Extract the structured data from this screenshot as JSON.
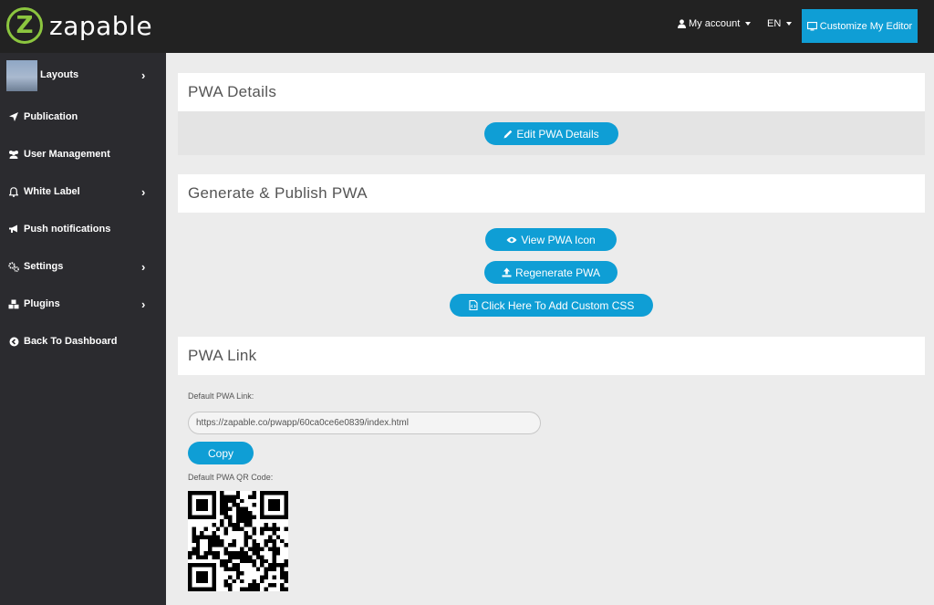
{
  "brand": {
    "logo_letter": "Z",
    "name": "zapable",
    "accent": "#8cc63f"
  },
  "topbar": {
    "account_label": "My account",
    "lang_label": "EN",
    "customize_label": "Customize My Editor",
    "account_icon": "user-icon",
    "customize_icon": "monitor-icon"
  },
  "sidebar": {
    "items": [
      {
        "label": "Layouts",
        "icon": "layouts-thumbnail",
        "has_chevron": true
      },
      {
        "label": "Publication",
        "icon": "paper-plane-icon",
        "has_chevron": false
      },
      {
        "label": "User Management",
        "icon": "users-icon",
        "has_chevron": false
      },
      {
        "label": "White Label",
        "icon": "bell-icon",
        "has_chevron": true
      },
      {
        "label": "Push notifications",
        "icon": "bullhorn-icon",
        "has_chevron": false
      },
      {
        "label": "Settings",
        "icon": "cogs-icon",
        "has_chevron": true
      },
      {
        "label": "Plugins",
        "icon": "cubes-icon",
        "has_chevron": true
      },
      {
        "label": "Back To Dashboard",
        "icon": "arrow-circle-left-icon",
        "has_chevron": false
      }
    ]
  },
  "pwa_details": {
    "title": "PWA Details",
    "edit_label": "Edit PWA Details"
  },
  "generate": {
    "title": "Generate & Publish PWA",
    "view_icon_label": "View PWA Icon",
    "regenerate_label": "Regenerate PWA",
    "custom_css_label": "Click Here To Add Custom CSS"
  },
  "pwa_link": {
    "title": "PWA Link",
    "default_link_label": "Default PWA Link:",
    "link_value": "https://zapable.co/pwapp/60ca0ce6e0839/index.html",
    "copy_label": "Copy",
    "qr_label": "Default PWA QR Code:"
  },
  "colors": {
    "primary": "#0f9ed5",
    "topbar": "#222222",
    "sidebar": "#2b2b2f"
  }
}
